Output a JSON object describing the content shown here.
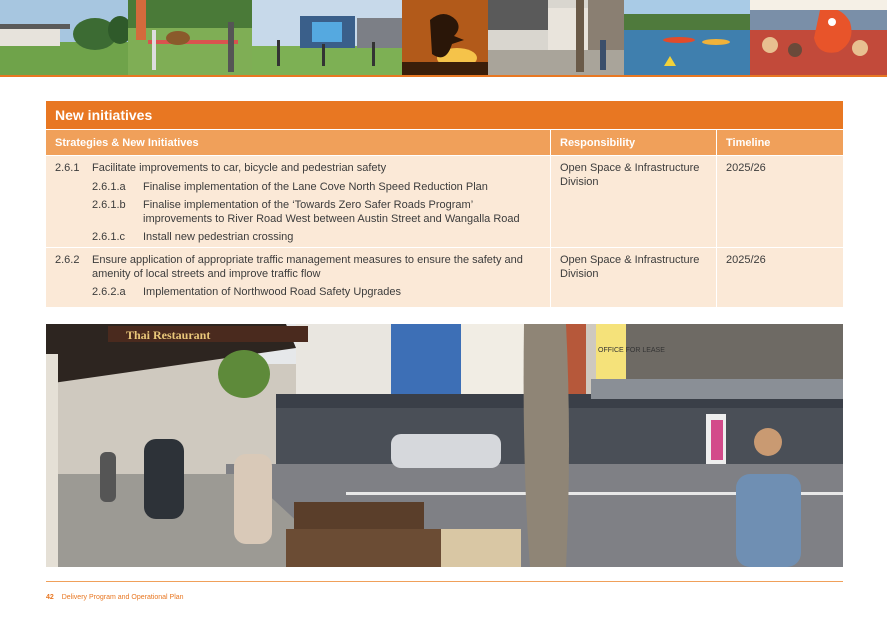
{
  "table": {
    "title": "New initiatives",
    "headers": {
      "strategy": "Strategies & New Initiatives",
      "responsibility": "Responsibility",
      "timeline": "Timeline"
    },
    "rows": [
      {
        "number": "2.6.1",
        "text": "Facilitate improvements to car, bicycle and pedestrian safety",
        "responsibility": "Open Space & Infrastructure Division",
        "timeline": "2025/26",
        "subitems": [
          {
            "number": "2.6.1.a",
            "text": "Finalise implementation of the Lane Cove North Speed Reduction Plan"
          },
          {
            "number": "2.6.1.b",
            "text": "Finalise implementation of the ‘Towards Zero Safer Roads Program’ improvements to River Road West between Austin Street and Wangalla Road"
          },
          {
            "number": "2.6.1.c",
            "text": "Install new pedestrian crossing"
          }
        ]
      },
      {
        "number": "2.6.2",
        "text": "Ensure application of appropriate traffic management measures to ensure the safety and amenity of local streets and improve traffic flow",
        "responsibility": "Open Space & Infrastructure Division",
        "timeline": "2025/26",
        "subitems": [
          {
            "number": "2.6.2.a",
            "text": "Implementation of Northwood Road Safety Upgrades"
          }
        ]
      }
    ]
  },
  "street_photo": {
    "sign_thai": "Thai Restaurant",
    "sign_lease": "OFFICE FOR LEASE"
  },
  "footer": {
    "page_number": "42",
    "doc_title": "Delivery Program and Operational Plan"
  },
  "colors": {
    "accent": "#e87722",
    "header_light": "#f0a05a",
    "row_bg": "#fbe9d7"
  }
}
